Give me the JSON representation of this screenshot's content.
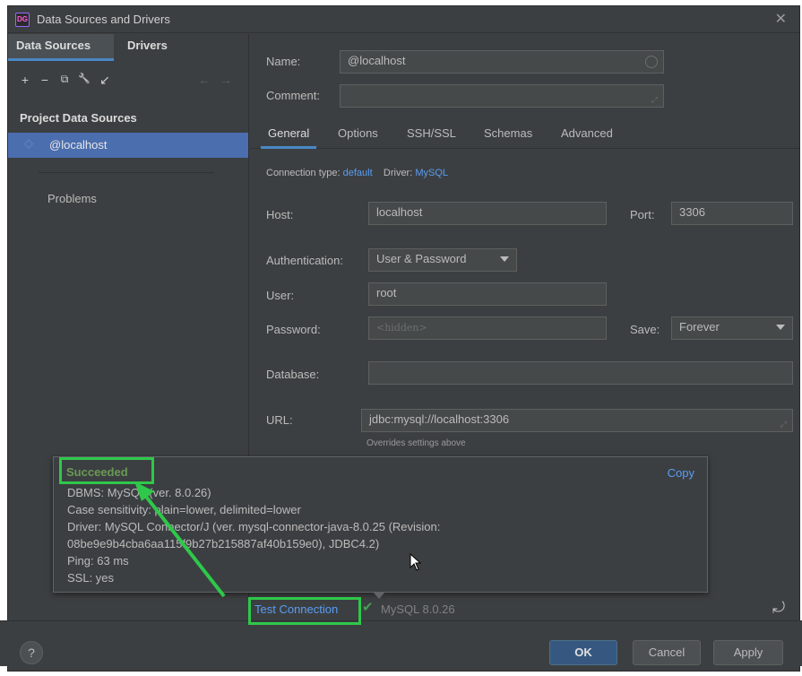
{
  "window": {
    "title": "Data Sources and Drivers",
    "app_icon_text": "DG",
    "close": "✕"
  },
  "left": {
    "tabs": [
      "Data Sources",
      "Drivers"
    ],
    "toolbar": [
      "+",
      "−",
      "⧉",
      "🔧",
      "↙",
      "←",
      "→"
    ],
    "project_label": "Project Data Sources",
    "datasource": "@localhost",
    "problems": "Problems"
  },
  "form": {
    "name_label": "Name:",
    "name_value": "@localhost",
    "comment_label": "Comment:",
    "comment_value": "",
    "tabs": [
      "General",
      "Options",
      "SSH/SSL",
      "Schemas",
      "Advanced"
    ],
    "conn_type_label": "Connection type:",
    "conn_type_value": "default",
    "driver_label": "Driver:",
    "driver_value": "MySQL",
    "host_label": "Host:",
    "host_value": "localhost",
    "port_label": "Port:",
    "port_value": "3306",
    "auth_label": "Authentication:",
    "auth_value": "User & Password",
    "user_label": "User:",
    "user_value": "root",
    "password_label": "Password:",
    "password_value": "<hidden>",
    "save_label": "Save:",
    "save_value": "Forever",
    "database_label": "Database:",
    "database_value": "",
    "url_label": "URL:",
    "url_value": "jdbc:mysql://localhost:3306",
    "overrides": "Overrides settings above"
  },
  "popup": {
    "status": "Succeeded",
    "copy": "Copy",
    "lines": [
      "DBMS: MySQL (ver. 8.0.26)",
      "Case sensitivity: plain=lower, delimited=lower",
      "Driver: MySQL Connector/J (ver. mysql-connector-java-8.0.25 (Revision:",
      "08be9e9b4cba6aa115f9b27b215887af40b159e0), JDBC4.2)",
      "Ping: 63 ms",
      "SSL: yes"
    ]
  },
  "bottom": {
    "test_connection": "Test Connection",
    "check": "✔",
    "mysql_version": "MySQL 8.0.26",
    "revert": "⤾"
  },
  "footer": {
    "help": "?",
    "ok": "OK",
    "cancel": "Cancel",
    "apply": "Apply"
  },
  "colors": {
    "accent": "#4a88c7",
    "link": "#589df6",
    "success": "#6a9955",
    "highlight": "#2ec84a",
    "selection": "#4b6eaf"
  }
}
